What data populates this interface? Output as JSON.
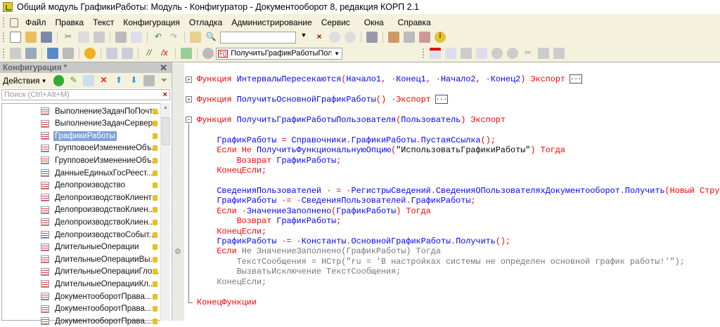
{
  "window": {
    "title": "Общий модуль ГрафикиРаботы: Модуль - Конфигуратор - Документооборот 8, редакция КОРП 2.1"
  },
  "menu": [
    "Файл",
    "Правка",
    "Текст",
    "Конфигурация",
    "Отладка",
    "Администрирование",
    "Сервис",
    "Окна",
    "Справка"
  ],
  "toolbar": {
    "search_value": "",
    "procedure_combo": "ПолучитьГрафикРаботыПользо"
  },
  "panel": {
    "title": "Конфигурация *",
    "actions_label": "Действия",
    "search_placeholder": "Поиск (Ctrl+Alt+M)",
    "items": [
      {
        "label": "ВыполнениеЗадачПоПочт..."
      },
      {
        "label": "ВыполнениеЗадачСервер"
      },
      {
        "label": "ГрафикиРаботы",
        "selected": true
      },
      {
        "label": "ГрупповоеИзменениеОбъ..."
      },
      {
        "label": "ГрупповоеИзменениеОбъ..."
      },
      {
        "label": "ДанныеЕдиныхГосРеест..."
      },
      {
        "label": "Делопроизводство"
      },
      {
        "label": "ДелопроизводствоКлиент"
      },
      {
        "label": "ДелопроизводствоКлиен..."
      },
      {
        "label": "ДелопроизводствоКлиен..."
      },
      {
        "label": "ДелопроизводствоСобыт..."
      },
      {
        "label": "ДлительныеОперации"
      },
      {
        "label": "ДлительныеОперацииВы..."
      },
      {
        "label": "ДлительныеОперацииГло..."
      },
      {
        "label": "ДлительныеОперацииКл..."
      },
      {
        "label": "ДокументооборотПрава..."
      },
      {
        "label": "ДокументооборотПрава..."
      },
      {
        "label": "ДокументооборотПрава..."
      }
    ]
  },
  "code": [
    {
      "fold": "+",
      "collapsed": true,
      "seg": [
        [
          "Функция ",
          "kw"
        ],
        [
          "ИнтервалыПересекаются",
          "id"
        ],
        [
          "(",
          "op"
        ],
        [
          "Начало1",
          "id"
        ],
        [
          ", ·",
          "op"
        ],
        [
          "Конец1",
          "id"
        ],
        [
          ", ·",
          "op"
        ],
        [
          "Начало2",
          "id"
        ],
        [
          ", ·",
          "op"
        ],
        [
          "Конец2",
          "id"
        ],
        [
          ") ",
          "op"
        ],
        [
          "Экспорт",
          "kw"
        ]
      ]
    },
    {
      "seg": []
    },
    {
      "fold": "+",
      "collapsed": true,
      "seg": [
        [
          "Функция ",
          "kw"
        ],
        [
          "ПолучитьОсновнойГрафикРаботы",
          "id"
        ],
        [
          "() ·",
          "op"
        ],
        [
          "Экспорт",
          "kw"
        ]
      ]
    },
    {
      "seg": []
    },
    {
      "fold": "-",
      "seg": [
        [
          "Функция ",
          "kw"
        ],
        [
          "ПолучитьГрафикРаботыПользователя",
          "id"
        ],
        [
          "(",
          "op"
        ],
        [
          "Пользователь",
          "id"
        ],
        [
          ") ",
          "op"
        ],
        [
          "Экспорт",
          "kw"
        ]
      ]
    },
    {
      "seg": []
    },
    {
      "seg": [
        [
          "    ",
          ""
        ],
        [
          "ГрафикРаботы",
          "id"
        ],
        [
          " = ",
          "op"
        ],
        [
          "Справочники",
          "id"
        ],
        [
          ".",
          "op"
        ],
        [
          "ГрафикиРаботы",
          "id"
        ],
        [
          ".",
          "op"
        ],
        [
          "ПустаяСсылка",
          "id"
        ],
        [
          "();",
          "op"
        ]
      ]
    },
    {
      "seg": [
        [
          "    ",
          ""
        ],
        [
          "Если Не ",
          "kw"
        ],
        [
          "ПолучитьФункциональнуюОпцию",
          "id"
        ],
        [
          "(",
          "op"
        ],
        [
          "\"ИспользоватьГрафикиРаботы\"",
          "st"
        ],
        [
          ") ",
          "op"
        ],
        [
          "Тогда",
          "kw"
        ]
      ]
    },
    {
      "seg": [
        [
          "        ",
          ""
        ],
        [
          "Возврат ",
          "kw"
        ],
        [
          "ГрафикРаботы",
          "id"
        ],
        [
          ";",
          "op"
        ]
      ]
    },
    {
      "seg": [
        [
          "    ",
          ""
        ],
        [
          "КонецЕсли;",
          "kw"
        ]
      ]
    },
    {
      "seg": []
    },
    {
      "seg": [
        [
          "    ",
          ""
        ],
        [
          "СведенияПользователей",
          "id"
        ],
        [
          " · = ·",
          "op"
        ],
        [
          "РегистрыСведений",
          "id"
        ],
        [
          ".",
          "op"
        ],
        [
          "СведенияОПользователяхДокументооборот",
          "id"
        ],
        [
          ".",
          "op"
        ],
        [
          "Получить",
          "id"
        ],
        [
          "(Новый Структ",
          "op"
        ]
      ]
    },
    {
      "seg": [
        [
          "    ",
          ""
        ],
        [
          "ГрафикРаботы",
          "id"
        ],
        [
          " ·= ·",
          "op"
        ],
        [
          "СведенияПользователей",
          "id"
        ],
        [
          ".",
          "op"
        ],
        [
          "ГрафикРаботы",
          "id"
        ],
        [
          ";",
          "op"
        ]
      ]
    },
    {
      "seg": [
        [
          "    ",
          ""
        ],
        [
          "Если ·",
          "kw"
        ],
        [
          "ЗначениеЗаполнено",
          "id"
        ],
        [
          "(",
          "op"
        ],
        [
          "ГрафикРаботы",
          "id"
        ],
        [
          ") ",
          "op"
        ],
        [
          "Тогда",
          "kw"
        ]
      ]
    },
    {
      "seg": [
        [
          "        ",
          ""
        ],
        [
          "Возврат ",
          "kw"
        ],
        [
          "ГрафикРаботы",
          "id"
        ],
        [
          ";",
          "op"
        ]
      ]
    },
    {
      "seg": [
        [
          "    ",
          ""
        ],
        [
          "КонецЕсли;",
          "kw"
        ]
      ]
    },
    {
      "seg": [
        [
          "    ",
          ""
        ],
        [
          "ГрафикРаботы",
          "id"
        ],
        [
          " ·= ·",
          "op"
        ],
        [
          "Константы",
          "id"
        ],
        [
          ".",
          "op"
        ],
        [
          "ОсновнойГрафикРаботы",
          "id"
        ],
        [
          ".",
          "op"
        ],
        [
          "Получить",
          "id"
        ],
        [
          "();",
          "op"
        ]
      ]
    },
    {
      "seg": [
        [
          "    ",
          ""
        ],
        [
          "Если ",
          "kw"
        ],
        [
          "Не ЗначениеЗаполнено(ГрафикРаботы) Тогда",
          "gr"
        ]
      ]
    },
    {
      "seg": [
        [
          "        ТекстСообщения = НСтр(\"ru = 'В настройках системы не определен основной график работы!'\");",
          "gr"
        ]
      ]
    },
    {
      "seg": [
        [
          "        ВызватьИсключение ТекстСообщения;",
          "gr"
        ]
      ]
    },
    {
      "seg": [
        [
          "    КонецЕсли;",
          "gr"
        ]
      ]
    },
    {
      "seg": []
    },
    {
      "seg": [
        [
          "КонецФункции",
          "kw"
        ]
      ]
    }
  ]
}
